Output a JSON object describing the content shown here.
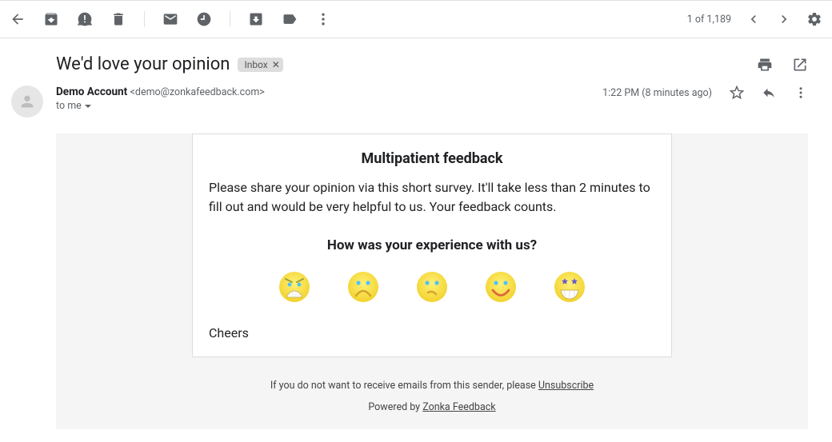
{
  "toolbar": {
    "position": "1 of 1,189"
  },
  "subject": "We'd love your opinion",
  "label_chip": "Inbox",
  "sender": {
    "name": "Demo Account",
    "email": "<demo@zonkafeedback.com>",
    "to_line": "to me",
    "time": "1:22 PM (8 minutes ago)"
  },
  "survey": {
    "title": "Multipatient feedback",
    "intro": "Please share your opinion via this short survey. It'll take less than 2 minutes to fill out and would be very helpful to us. Your feedback counts.",
    "question": "How was your experience with us?",
    "signoff": "Cheers",
    "faces": [
      "angry",
      "sad",
      "confused",
      "happy",
      "excited"
    ]
  },
  "footer": {
    "text": "If you do not want to receive emails from this sender, please ",
    "unsubscribe": "Unsubscribe",
    "powered_prefix": "Powered by ",
    "powered_link": "Zonka Feedback"
  }
}
